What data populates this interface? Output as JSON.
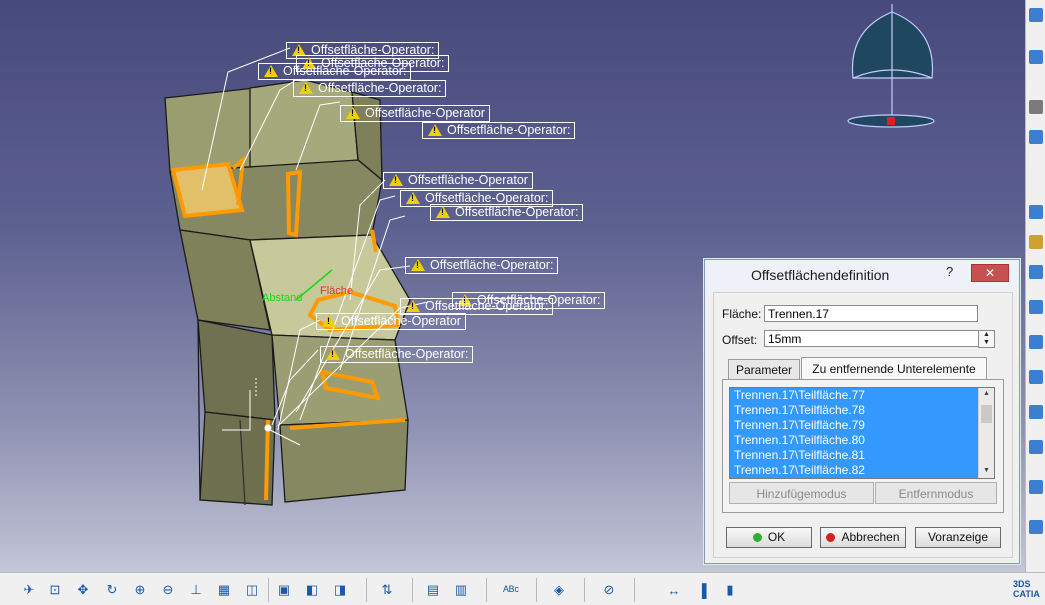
{
  "viewport": {
    "callout_text": "Offsetfläche-Operator:",
    "callout_text_alt": "Offsetfläche-Operator",
    "label_distance": "Abstand",
    "label_surface": "Fläche"
  },
  "dialog": {
    "title": "Offsetflächendefinition",
    "help": "?",
    "close": "✕",
    "flaeche_label": "Fläche:",
    "flaeche_value": "Trennen.17",
    "offset_label": "Offset:",
    "offset_value": "15mm",
    "tabs": [
      {
        "label": "Parameter",
        "active": false
      },
      {
        "label": "Zu entfernende Unterelemente",
        "active": true
      }
    ],
    "list_items": [
      "Trennen.17\\Teilfläche.77",
      "Trennen.17\\Teilfläche.78",
      "Trennen.17\\Teilfläche.79",
      "Trennen.17\\Teilfläche.80",
      "Trennen.17\\Teilfläche.81",
      "Trennen.17\\Teilfläche.82"
    ],
    "add_mode": "Hinzufügemodus",
    "remove_mode": "Entfernmodus",
    "ok": "OK",
    "cancel": "Abbrechen",
    "preview": "Voranzeige"
  },
  "colors": {
    "ok_dot": "#2fae2f",
    "cancel_dot": "#d42020",
    "selection_blue": "#3399ff",
    "warning_yellow": "#f1d000",
    "highlight_orange": "#ff9a00",
    "part_olive": "#8f9269"
  },
  "toolbar": {
    "icons": [
      "fly-mode-icon",
      "fit-all-icon",
      "pan-icon",
      "rotate-icon",
      "zoom-in-icon",
      "zoom-out-icon",
      "normal-view-icon",
      "iso-view-icon",
      "view-mode-icon",
      "hide-show-icon",
      "swap-visible-icon",
      "create-multiview-icon",
      "measure-icon",
      "property-icon",
      "text-annotation-icon",
      "apply-material-icon",
      "compass-icon",
      "scale-icon",
      "parallel-icon",
      "hold-icon"
    ],
    "brand": "3DS CATIA"
  }
}
